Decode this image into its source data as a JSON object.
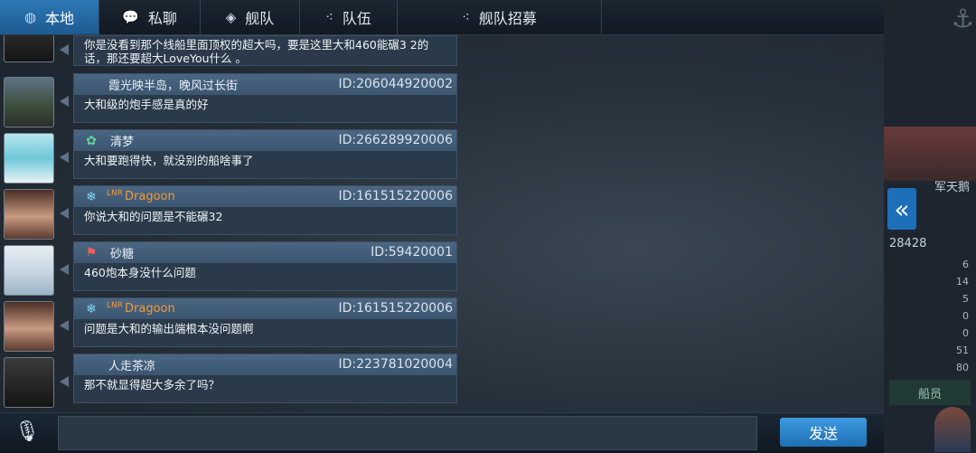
{
  "tabs": [
    {
      "label": "本地",
      "icon": "globe-icon"
    },
    {
      "label": "私聊",
      "icon": "chat-bubble-icon"
    },
    {
      "label": "舰队",
      "icon": "fleet-icon"
    },
    {
      "label": "队伍",
      "icon": "team-icon"
    },
    {
      "label": "舰队招募",
      "icon": "recruit-icon"
    }
  ],
  "messages": [
    {
      "name": "",
      "id": "",
      "text": "你是没看到那个线船里面顶权的超大吗，要是这里大和460能碾3 2的话，那还要超大LoveYou什么 。"
    },
    {
      "name": "霞光映半岛，晚风过长街",
      "id": "ID:206044920002",
      "text": "大和级的炮手感是真的好"
    },
    {
      "name": "清梦",
      "id": "ID:266289920006",
      "text": "大和要跑得快，就没别的船啥事了"
    },
    {
      "name": "Dragoon",
      "id": "ID:161515220006",
      "text": "你说大和的问题是不能碾32",
      "prefix": "LNR"
    },
    {
      "name": "砂糖",
      "id": "ID:59420001",
      "text": "460炮本身没什么问题"
    },
    {
      "name": "Dragoon",
      "id": "ID:161515220006",
      "text": "问题是大和的输出端根本没问题啊",
      "prefix": "LNR"
    },
    {
      "name": "人走茶凉",
      "id": "ID:223781020004",
      "text": "那不就显得超大多余了吗？"
    }
  ],
  "send_label": "发送",
  "right_panel": {
    "score": "28428",
    "partial_label": "军天鹅",
    "stats": [
      "6",
      "14",
      "5",
      "0",
      "0",
      "51",
      "80"
    ],
    "crew_label": "船员"
  }
}
